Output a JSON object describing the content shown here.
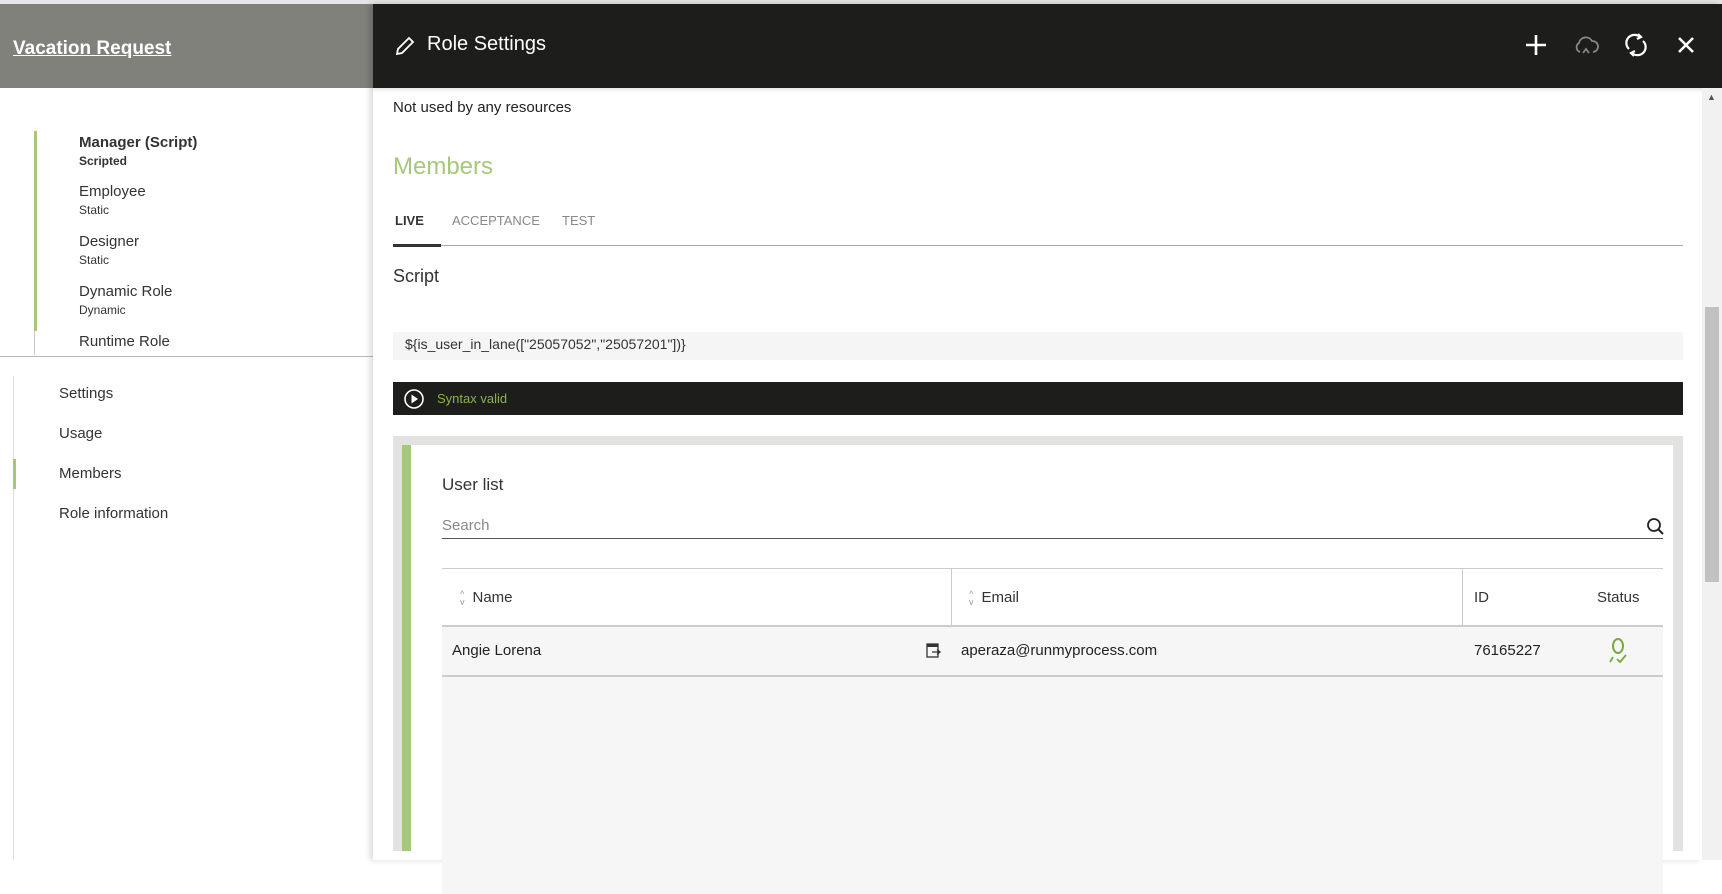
{
  "app": {
    "title": "Vacation Request"
  },
  "roles": [
    {
      "name": "Manager (Script)",
      "type": "Scripted",
      "active": true
    },
    {
      "name": "Employee",
      "type": "Static"
    },
    {
      "name": "Designer",
      "type": "Static"
    },
    {
      "name": "Dynamic Role",
      "type": "Dynamic"
    },
    {
      "name": "Runtime Role",
      "type": ""
    }
  ],
  "nav": [
    {
      "label": "Settings"
    },
    {
      "label": "Usage"
    },
    {
      "label": "Members",
      "active": true
    },
    {
      "label": "Role information"
    }
  ],
  "panel": {
    "title": "Role Settings",
    "icons": [
      "plus-icon",
      "cloud-upload-icon",
      "refresh-icon",
      "close-icon"
    ],
    "usage_text": "Not used by any resources",
    "members_title": "Members",
    "tabs": [
      {
        "label": "LIVE",
        "active": true
      },
      {
        "label": "ACCEPTANCE"
      },
      {
        "label": "TEST"
      }
    ],
    "script_title": "Script",
    "script_code": "${is_user_in_lane([\"25057052\",\"25057201\"])}",
    "syntax_status": "Syntax valid"
  },
  "user_list": {
    "title": "User list",
    "search_placeholder": "Search",
    "columns": [
      "Name",
      "Email",
      "ID",
      "Status"
    ],
    "rows": [
      {
        "name": "Angie Lorena",
        "email": "aperaza@runmyprocess.com",
        "id": "76165227",
        "status": "active-user-icon"
      }
    ]
  },
  "colors": {
    "accent": "#a6c87a",
    "header": "#1d1d1b",
    "left_header": "#81817c",
    "valid": "#8cb34a"
  }
}
